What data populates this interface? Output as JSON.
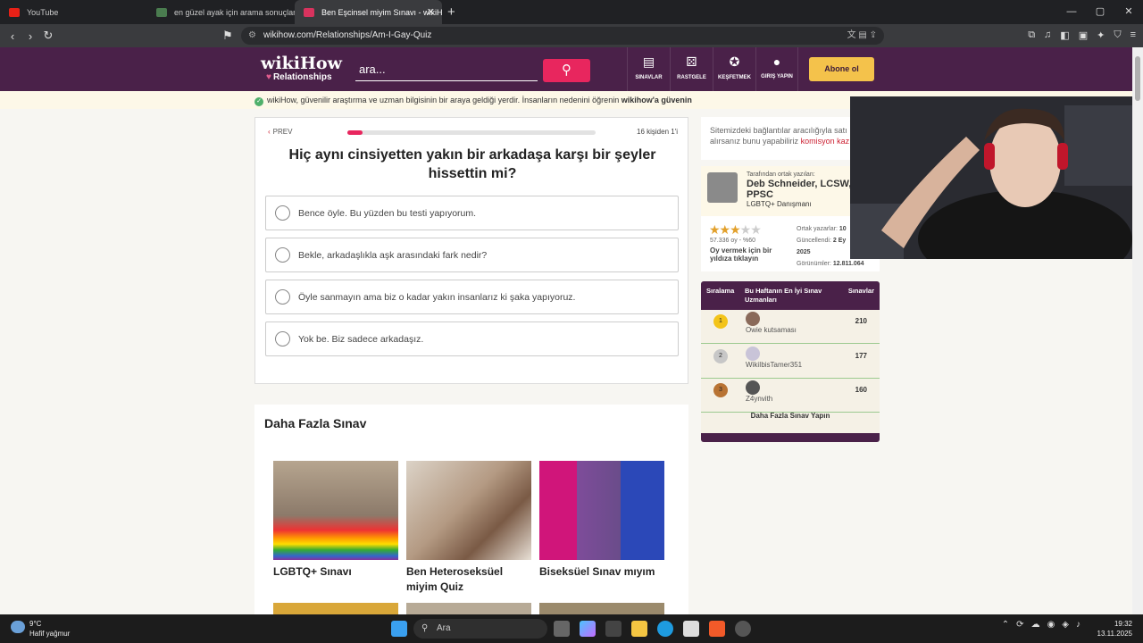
{
  "browser": {
    "tabs": [
      {
        "title": "YouTube",
        "color": "#e62117"
      },
      {
        "title": "en güzel ayak için arama sonuçları - ",
        "color": "#4a7c4f"
      },
      {
        "title": "Ben Eşcinsel miyim Sınavı - wikiH",
        "color": "#d8335e"
      }
    ],
    "url": "wikihow.com/Relationships/Am-I-Gay-Quiz"
  },
  "header": {
    "logo": "wikiHow",
    "logo_sub": "Relationships",
    "search_placeholder": "ara...",
    "nav": [
      {
        "label": "SINAVLAR",
        "icon": "quiz-icon"
      },
      {
        "label": "RASTGELE",
        "icon": "dice-icon"
      },
      {
        "label": "KEŞFETMEK",
        "icon": "compass-icon"
      },
      {
        "label": "GIRIŞ YAPIN",
        "icon": "user-icon"
      }
    ],
    "subscribe": "Abone ol"
  },
  "trust": {
    "text": "wikiHow, güvenilir araştırma ve uzman bilgisinin bir araya geldiği yerdir. İnsanların nedenini öğrenin ",
    "bold": "wikihow'a güvenin"
  },
  "quiz": {
    "prev": "PREV",
    "progress_fraction": 0.0625,
    "counter": "16 kişiden 1'i",
    "question": "Hiç aynı cinsiyetten yakın bir arkadaşa karşı bir şeyler hissettin mi?",
    "options": [
      "Bence öyle. Bu yüzden bu testi yapıyorum.",
      "Bekle, arkadaşlıkla aşk arasındaki fark nedir?",
      "Öyle sanmayın ama biz o kadar yakın insanlarız ki şaka yapıyoruz.",
      "Yok be. Biz sadece arkadaşız."
    ]
  },
  "more": {
    "title": "Daha Fazla Sınav",
    "cards": [
      {
        "label": "LGBTQ+ Sınavı"
      },
      {
        "label": "Ben Heteroseksüel miyim Quiz"
      },
      {
        "label": "Biseksüel Sınav mıyım"
      }
    ]
  },
  "sidebar": {
    "affiliate_text": "Sitemizdeki bağlantılar aracılığıyla satı alırsanız bunu yapabiliriz ",
    "affiliate_link": "komisyon kaz",
    "author_small": "Tarafından ortak yazılan:",
    "author_name": "Deb Schneider, LCSW, PPSC",
    "author_role": "LGBTQ+ Danışmanı",
    "stars": 3,
    "votes": "57.336 oy - %60",
    "vote_label": "Oy vermek için bir yıldıza tıklayın",
    "coauthors_label": "Ortak yazarlar: ",
    "coauthors_value": "10",
    "updated_label": "Güncellendi: ",
    "updated_value": "2 Ey",
    "updated_year": "2025",
    "views_label": "Görünümler: ",
    "views_value": "12.811.064"
  },
  "board": {
    "col_rank": "Sıralama",
    "col_experts": "Bu Haftanın En İyi Sınav Uzmanları",
    "col_quizzes": "Sınavlar",
    "rows": [
      {
        "rank": "1",
        "name": "Owie kutsaması",
        "score": "210",
        "color": "#f3c41a"
      },
      {
        "rank": "2",
        "name": "WikiIbisTamer351",
        "score": "177",
        "color": "#c7c7c7"
      },
      {
        "rank": "3",
        "name": "Z4ynvith",
        "score": "160",
        "color": "#b87333"
      }
    ],
    "more": "Daha Fazla Sınav Yapın"
  },
  "taskbar": {
    "temp": "9°C",
    "weather": "Hafif yağmur",
    "search": "Ara",
    "time": "19:32",
    "date": "13.11.2025"
  }
}
